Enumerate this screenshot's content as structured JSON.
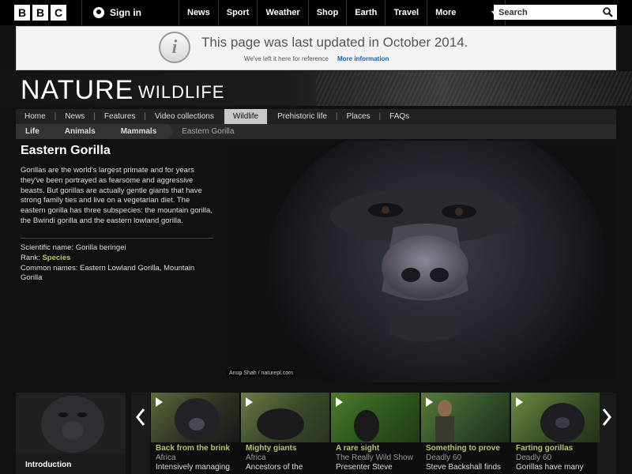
{
  "global_nav": {
    "logo_letters": [
      "B",
      "B",
      "C"
    ],
    "sign_in": "Sign in",
    "items": [
      "News",
      "Sport",
      "Weather",
      "Shop",
      "Earth",
      "Travel"
    ],
    "more": "More",
    "search_placeholder": "Search"
  },
  "notice": {
    "icon_letter": "i",
    "title": "This page was last updated in October 2014.",
    "subtitle": "We've left it here for reference",
    "link": "More information"
  },
  "masthead": {
    "title": "NATURE",
    "subtitle": "WILDLIFE"
  },
  "section_nav": {
    "items": [
      "Home",
      "News",
      "Features",
      "Video collections",
      "Wildlife",
      "Prehistoric life",
      "Places",
      "FAQs"
    ],
    "active": "Wildlife"
  },
  "breadcrumb": [
    "Life",
    "Animals",
    "Mammals",
    "Eastern Gorilla"
  ],
  "species": {
    "name": "Eastern Gorilla",
    "description": "Gorillas are the world's largest primate and for years they've been portrayed as fearsome and aggressive beasts. But gorillas are actually gentle giants that have strong family ties and live on a vegetarian diet. The eastern gorilla has three subspecies: the mountain gorilla, the Bwindi gorilla and the eastern lowland gorilla.",
    "scientific_name_label": "Scientific name:",
    "scientific_name": "Gorilla beringei",
    "rank_label": "Rank:",
    "rank": "Species",
    "common_names_label": "Common names:",
    "common_names": "Eastern Lowland Gorilla, Mountain Gorilla"
  },
  "hero": {
    "credit": "Anup Shah / naturepl.com"
  },
  "intro": {
    "label": "Introduction"
  },
  "carousel": [
    {
      "title": "Back from the brink",
      "sub": "Africa",
      "desc": "Intensively managing"
    },
    {
      "title": "Mighty giants",
      "sub": "Africa",
      "desc": "Ancestors of the"
    },
    {
      "title": "A rare sight",
      "sub": "The Really Wild Show",
      "desc": "Presenter Steve"
    },
    {
      "title": "Something to prove",
      "sub": "Deadly 60",
      "desc": "Steve Backshall finds"
    },
    {
      "title": "Farting gorillas",
      "sub": "Deadly 60",
      "desc": "Gorillas have many"
    }
  ],
  "colors": {
    "accent_green": "#b6c66a",
    "link_blue": "#1a5ec2"
  }
}
